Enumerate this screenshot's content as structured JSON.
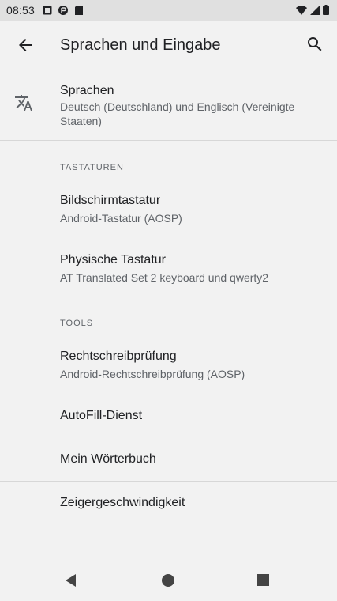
{
  "status_bar": {
    "time": "08:53",
    "icons": [
      "notification-icon",
      "app-icon",
      "sd-card-icon"
    ],
    "right_icons": [
      "wifi-icon",
      "signal-icon",
      "battery-icon"
    ]
  },
  "toolbar": {
    "title": "Sprachen und Eingabe",
    "back_icon": "arrow-back-icon",
    "search_icon": "search-icon"
  },
  "languages": {
    "title": "Sprachen",
    "summary": "Deutsch (Deutschland) und Englisch (Vereinigte Staaten)",
    "icon": "translate-icon"
  },
  "sections": {
    "keyboards_header": "TASTATUREN",
    "tools_header": "TOOLS"
  },
  "keyboards": {
    "onscreen": {
      "title": "Bildschirmtastatur",
      "summary": "Android-Tastatur (AOSP)"
    },
    "physical": {
      "title": "Physische Tastatur",
      "summary": "AT Translated Set 2 keyboard und qwerty2"
    }
  },
  "tools": {
    "spellcheck": {
      "title": "Rechtschreibprüfung",
      "summary": "Android-Rechtschreibprüfung (AOSP)"
    },
    "autofill": {
      "title": "AutoFill-Dienst"
    },
    "dictionary": {
      "title": "Mein Wörterbuch"
    }
  },
  "pointer": {
    "title": "Zeigergeschwindigkeit"
  },
  "nav_bar": {
    "back": "nav-back-icon",
    "home": "nav-home-icon",
    "recents": "nav-recents-icon"
  }
}
